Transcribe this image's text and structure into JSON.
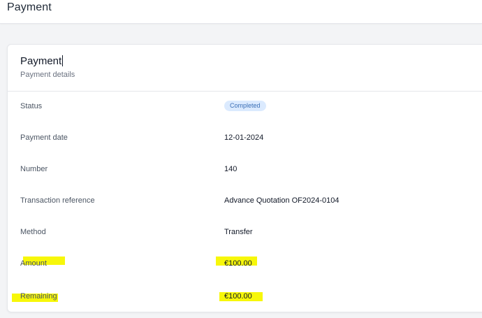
{
  "topbar": {
    "title": "Payment"
  },
  "card": {
    "title": "Payment",
    "subtitle": "Payment details",
    "status": {
      "label": "Status",
      "value": "Completed"
    },
    "payment_date": {
      "label": "Payment date",
      "value": "12-01-2024"
    },
    "number": {
      "label": "Number",
      "value": "140"
    },
    "transaction_reference": {
      "label": "Transaction reference",
      "value": "Advance Quotation OF2024-0104"
    },
    "method": {
      "label": "Method",
      "value": "Transfer"
    },
    "amount": {
      "label": "Amount",
      "value": "€100.00"
    },
    "remaining": {
      "label": "Remaining",
      "value": "€100.00"
    }
  },
  "colors": {
    "highlight": "#f7f70a",
    "badge_bg": "#dbeafe",
    "badge_text": "#3b6fb5"
  }
}
